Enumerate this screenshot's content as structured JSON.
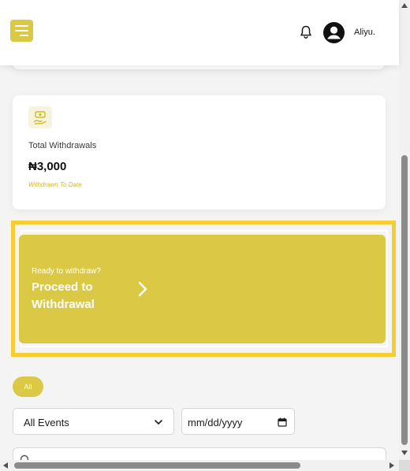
{
  "header": {
    "menu_icon": "hamburger-menu-icon",
    "notification_icon": "bell-icon",
    "avatar_icon": "user-circle-icon",
    "username": "Aliyu."
  },
  "withdrawals_card": {
    "icon": "money-hand-icon",
    "label": "Total Withdrawals",
    "value": "₦3,000",
    "subtext": "Withdrawn To Date"
  },
  "withdraw_cta": {
    "kicker": "Ready to withdraw?",
    "title": "Proceed to Withdrawal",
    "icon": "chevron-right-icon"
  },
  "filters": {
    "chip_label": "All",
    "event_select_value": "All Events",
    "date_placeholder": "mm/dd/yyyy"
  },
  "colors": {
    "accent": "#dbc945",
    "highlight": "#f7cd35",
    "subtext": "#cdb82f"
  }
}
